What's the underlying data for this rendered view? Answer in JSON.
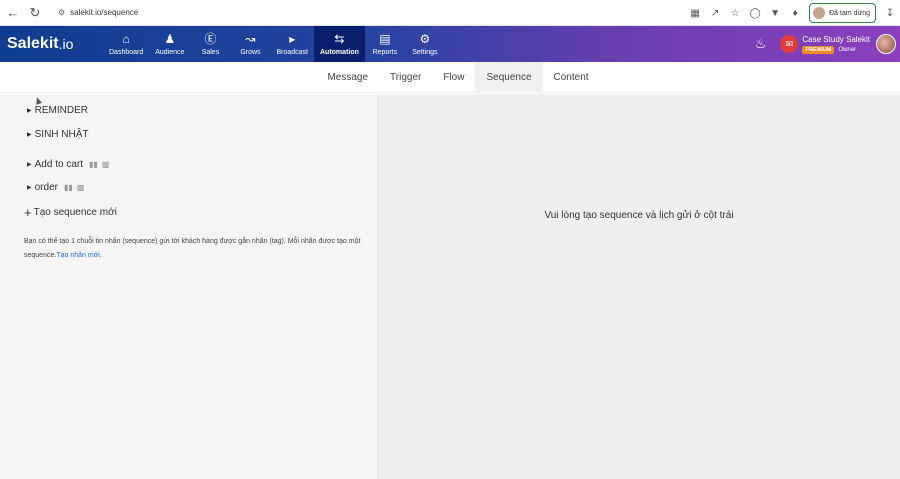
{
  "browser": {
    "url": "salekit.io/sequence",
    "paused_label": "Đã tạm dừng"
  },
  "app": {
    "logo_main": "Salekit",
    "logo_suffix": ".io",
    "menu": [
      {
        "label": "Dashboard",
        "icon": "home-icon"
      },
      {
        "label": "Audience",
        "icon": "users-icon"
      },
      {
        "label": "Sales",
        "icon": "dollar-icon"
      },
      {
        "label": "Grows",
        "icon": "chart-icon"
      },
      {
        "label": "Broadcast",
        "icon": "megaphone-icon"
      },
      {
        "label": "Automation",
        "icon": "sync-icon"
      },
      {
        "label": "Reports",
        "icon": "reports-icon"
      },
      {
        "label": "Settings",
        "icon": "gear-icon"
      }
    ],
    "account_name": "Case Study Salekit",
    "account_badge": "PREMIUM",
    "account_role": "Owner"
  },
  "tabs": [
    "Message",
    "Trigger",
    "Flow",
    "Sequence",
    "Content"
  ],
  "active_tab": "Sequence",
  "sequences": {
    "groups": [
      {
        "label": "REMINDER"
      },
      {
        "label": "SINH NHẬT"
      }
    ],
    "items": [
      {
        "label": "Add to cart"
      },
      {
        "label": "order"
      }
    ],
    "new_label": "Tạo sequence mới",
    "help_text": "Bạn có thể tạo 1 chuỗi tin nhắn (sequence) gửi tới khách hàng được gắn nhãn (tag). Mỗi nhãn được tạo một sequence.",
    "help_link": "Tạo nhãn mới."
  },
  "empty_state": "Vui lòng tạo sequence và lịch gửi ở cột trái"
}
